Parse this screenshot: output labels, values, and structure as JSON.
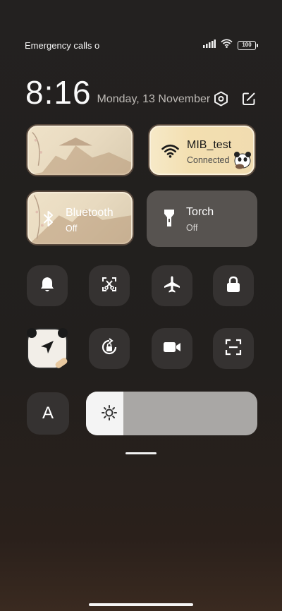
{
  "status_bar": {
    "carrier_text": "Emergency calls o",
    "battery_level": "100",
    "signal_icon": "signal-bars-icon",
    "wifi_icon": "wifi-icon"
  },
  "clock": {
    "time": "8:16",
    "date": "Monday, 13 November",
    "actions": [
      "settings-hexagon-icon",
      "edit-icon"
    ]
  },
  "tiles": {
    "mobile_data": {
      "title": "",
      "subtitle": ""
    },
    "wifi": {
      "title": "MIB_test",
      "subtitle": "Connected",
      "active": true
    },
    "bluetooth": {
      "title": "Bluetooth",
      "subtitle": "Off",
      "active": false
    },
    "torch": {
      "title": "Torch",
      "subtitle": "Off",
      "active": false
    }
  },
  "toggles_row1": [
    "bell-icon",
    "screenshot-icon",
    "airplane-icon",
    "lock-icon"
  ],
  "toggles_row2": [
    "location-icon",
    "rotation-lock-icon",
    "video-record-icon",
    "scan-icon"
  ],
  "reading_mode_label": "A",
  "brightness": {
    "level": 0.22
  },
  "colors": {
    "background": "#221f1d",
    "tile_inactive": "#575350",
    "tile_active": "#f3dfb0",
    "button_bg": "#353231",
    "brightness_fill": "#f4f4f4"
  }
}
